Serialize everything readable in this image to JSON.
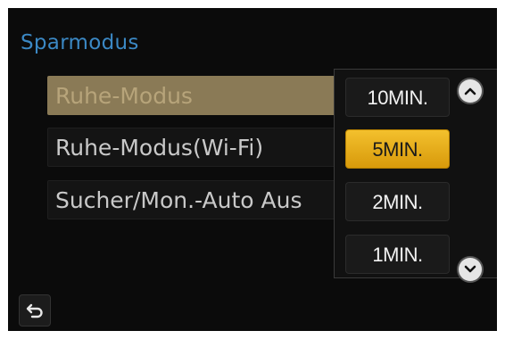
{
  "menu": {
    "title": "Sparmodus",
    "items": [
      {
        "label": "Ruhe-Modus",
        "selected": true
      },
      {
        "label": "Ruhe-Modus(Wi-Fi)",
        "selected": false
      },
      {
        "label": "Sucher/Mon.-Auto Aus",
        "selected": false
      }
    ]
  },
  "popup": {
    "options": [
      "10MIN.",
      "5MIN.",
      "2MIN.",
      "1MIN."
    ],
    "selected": "5MIN."
  },
  "icons": {
    "scroll_up": "chevron-up-icon",
    "scroll_down": "chevron-down-icon",
    "back": "return-arrow-icon"
  },
  "colors": {
    "title": "#3b88c4",
    "selected_item": "#8a7a56",
    "selected_option": "#f3c02d"
  }
}
